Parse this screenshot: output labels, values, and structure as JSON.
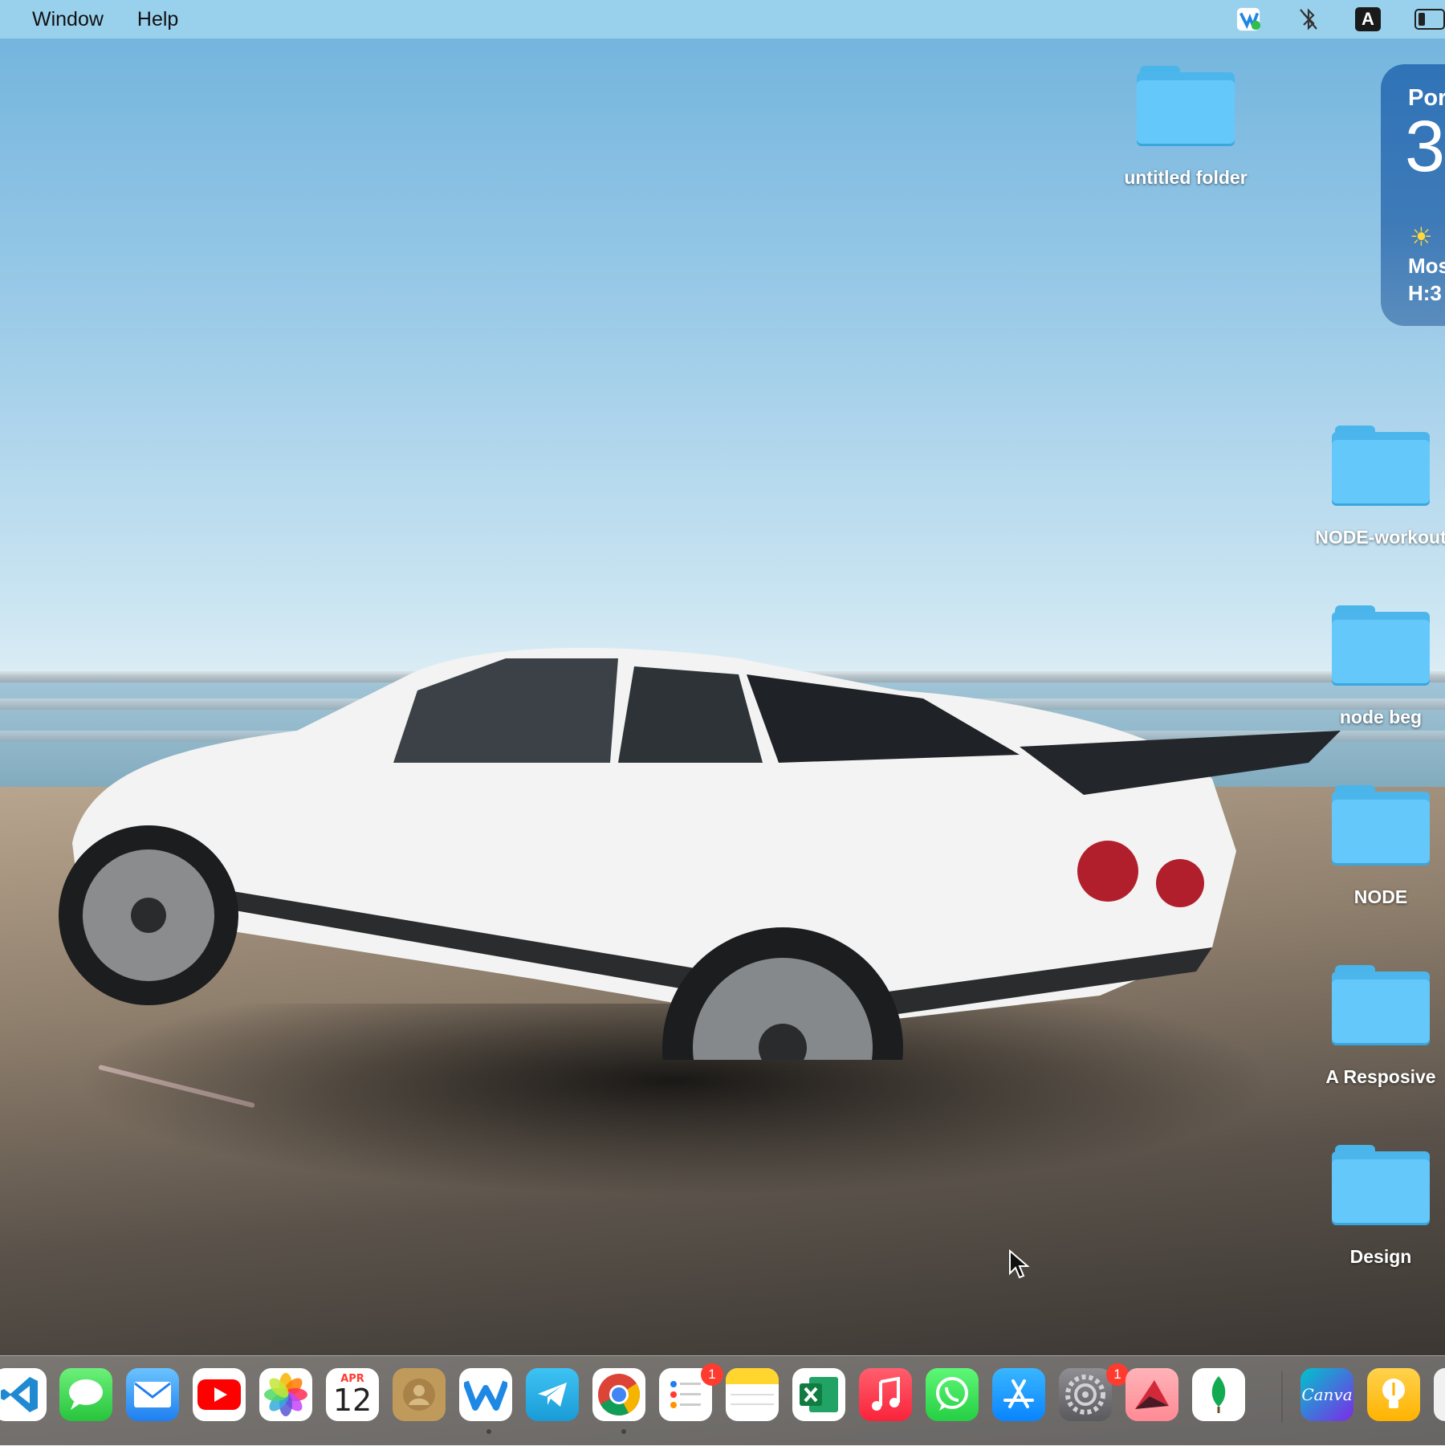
{
  "menubar": {
    "items": [
      "Window",
      "Help"
    ],
    "status_icons": [
      "vpn-status-icon",
      "bluetooth-off-icon",
      "keyboard-input-icon",
      "battery-icon"
    ],
    "keyboard_input_letter": "A"
  },
  "desktop": {
    "folders": [
      {
        "label": "untitled folder"
      },
      {
        "label": "NODE-workout"
      },
      {
        "label": "node beg"
      },
      {
        "label": "NODE"
      },
      {
        "label": "A Resposive"
      },
      {
        "label": "Design"
      }
    ]
  },
  "weather_widget": {
    "city": "Por",
    "temperature": "3",
    "condition": "Mos",
    "high_low": "H:3"
  },
  "dock": {
    "apps": [
      {
        "name": "Visual Studio Code",
        "icon": "vscode-icon"
      },
      {
        "name": "Messages",
        "icon": "messages-icon"
      },
      {
        "name": "Mail",
        "icon": "mail-icon"
      },
      {
        "name": "YouTube",
        "icon": "youtube-icon"
      },
      {
        "name": "Photos",
        "icon": "photos-icon"
      },
      {
        "name": "Calendar",
        "icon": "calendar-icon",
        "month": "APR",
        "day": "12"
      },
      {
        "name": "Contacts",
        "icon": "contacts-icon"
      },
      {
        "name": "Webex",
        "icon": "webex-icon",
        "running": true
      },
      {
        "name": "Telegram",
        "icon": "telegram-icon"
      },
      {
        "name": "Google Chrome",
        "icon": "chrome-icon",
        "running": true
      },
      {
        "name": "Reminders",
        "icon": "reminders-icon",
        "badge": "1"
      },
      {
        "name": "Notes",
        "icon": "notes-icon"
      },
      {
        "name": "Microsoft Excel",
        "icon": "excel-icon"
      },
      {
        "name": "Music",
        "icon": "music-icon"
      },
      {
        "name": "WhatsApp",
        "icon": "whatsapp-icon"
      },
      {
        "name": "App Store",
        "icon": "app-store-icon"
      },
      {
        "name": "System Preferences",
        "icon": "settings-icon",
        "badge": "1"
      },
      {
        "name": "Affinity",
        "icon": "affinity-icon"
      },
      {
        "name": "MongoDB Compass",
        "icon": "mongodb-icon"
      },
      {
        "name": "Canva",
        "icon": "canva-icon",
        "text": "Canva"
      },
      {
        "name": "Tips",
        "icon": "tips-icon"
      }
    ]
  },
  "colors": {
    "folder": "#64c9fa",
    "badge": "#ff3b30",
    "widget": "#2f73b7"
  }
}
